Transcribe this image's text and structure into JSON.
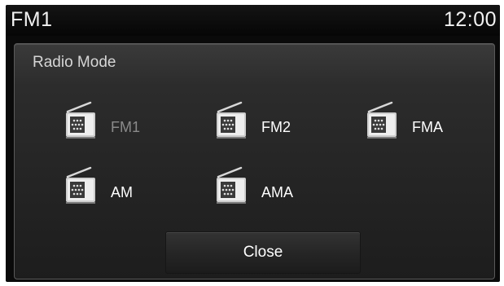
{
  "header": {
    "title": "FM1",
    "clock": "12:00"
  },
  "dialog": {
    "title": "Radio Mode",
    "close_label": "Close",
    "options": [
      {
        "label": "FM1",
        "icon": "radio-icon",
        "selected": true
      },
      {
        "label": "FM2",
        "icon": "radio-icon",
        "selected": false
      },
      {
        "label": "FMA",
        "icon": "radio-icon",
        "selected": false
      },
      {
        "label": "AM",
        "icon": "radio-icon",
        "selected": false
      },
      {
        "label": "AMA",
        "icon": "radio-icon",
        "selected": false
      }
    ]
  },
  "colors": {
    "background": "#0a0a0a",
    "panel": "#2a2a2a",
    "text": "#ffffff",
    "selected_text": "#8a8a8a"
  }
}
